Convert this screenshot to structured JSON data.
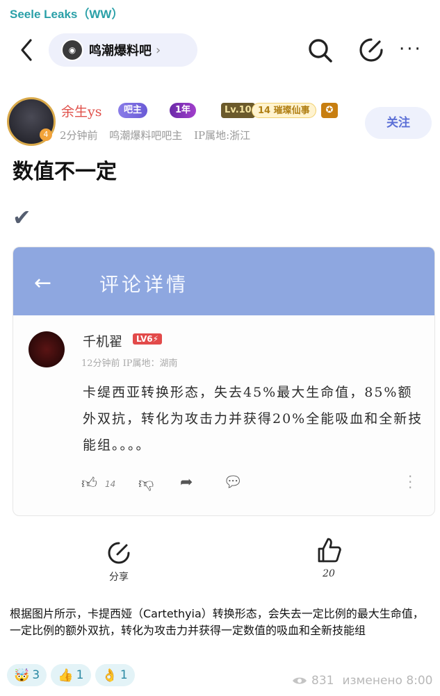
{
  "channel": {
    "name": "Seele Leaks（WW）"
  },
  "nav": {
    "forum_name": "鸣潮爆料吧",
    "chevron": "›",
    "more": "···"
  },
  "author": {
    "name": "余生ys",
    "badges": {
      "admin": "吧主",
      "years": "1年",
      "level": "Lv.10",
      "title": "14 璀璨仙事",
      "avatar_level": "4"
    },
    "meta": "2分钟前 鸣潮爆料吧吧主 IP属地:浙江",
    "follow": "关注"
  },
  "post": {
    "title": "数值不一定",
    "check": "✔"
  },
  "screenshot": {
    "header_title": "评论详情",
    "user": "千机翟",
    "user_level": "LV6⚡",
    "meta": "12分钟前 IP属地：湖南",
    "text": "卡缇西亚转换形态，失去45%最大生命值，85%额外双抗，转化为攻击力并获得20%全能吸血和全新技能组。。。。",
    "likes": "14"
  },
  "actions": {
    "share_label": "分享",
    "like_count": "20"
  },
  "description": "根据图片所示，卡提西娅（Cartethyia）转换形态，会失去一定比例的最大生命值，一定比例的额外双抗，转化为攻击力并获得一定数值的吸血和全新技能组",
  "reactions": [
    {
      "emoji": "🤯",
      "count": "3"
    },
    {
      "emoji": "👍",
      "count": "1"
    },
    {
      "emoji": "👌",
      "count": "1"
    }
  ],
  "footer": {
    "views": "831",
    "edited": "изменено 8:00"
  },
  "colors": {
    "accent": "#2aa0a8",
    "header_blue": "#8ea7e0",
    "follow_text": "#5b6fd6",
    "name_red": "#e0504a"
  }
}
